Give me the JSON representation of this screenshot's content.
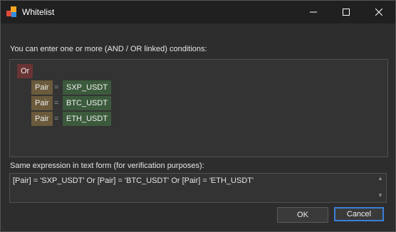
{
  "window": {
    "title": "Whitelist"
  },
  "labels": {
    "conditions": "You can enter one or more (AND / OR linked) conditions:",
    "text_form": "Same expression in text form (for verification purposes):"
  },
  "expression_tree": {
    "operator": "Or",
    "conditions": [
      {
        "field": "Pair",
        "op": "=",
        "value": "SXP_USDT"
      },
      {
        "field": "Pair",
        "op": "=",
        "value": "BTC_USDT"
      },
      {
        "field": "Pair",
        "op": "=",
        "value": "ETH_USDT"
      }
    ]
  },
  "expression_text": "[Pair] = 'SXP_USDT' Or [Pair] = 'BTC_USDT' Or [Pair] = 'ETH_USDT'",
  "buttons": {
    "ok": "OK",
    "cancel": "Cancel"
  },
  "colors": {
    "or_tag": "#6a3434",
    "field_tag": "#6b5a3c",
    "value_tag": "#3c5a3c",
    "focus": "#3a7fd4"
  }
}
